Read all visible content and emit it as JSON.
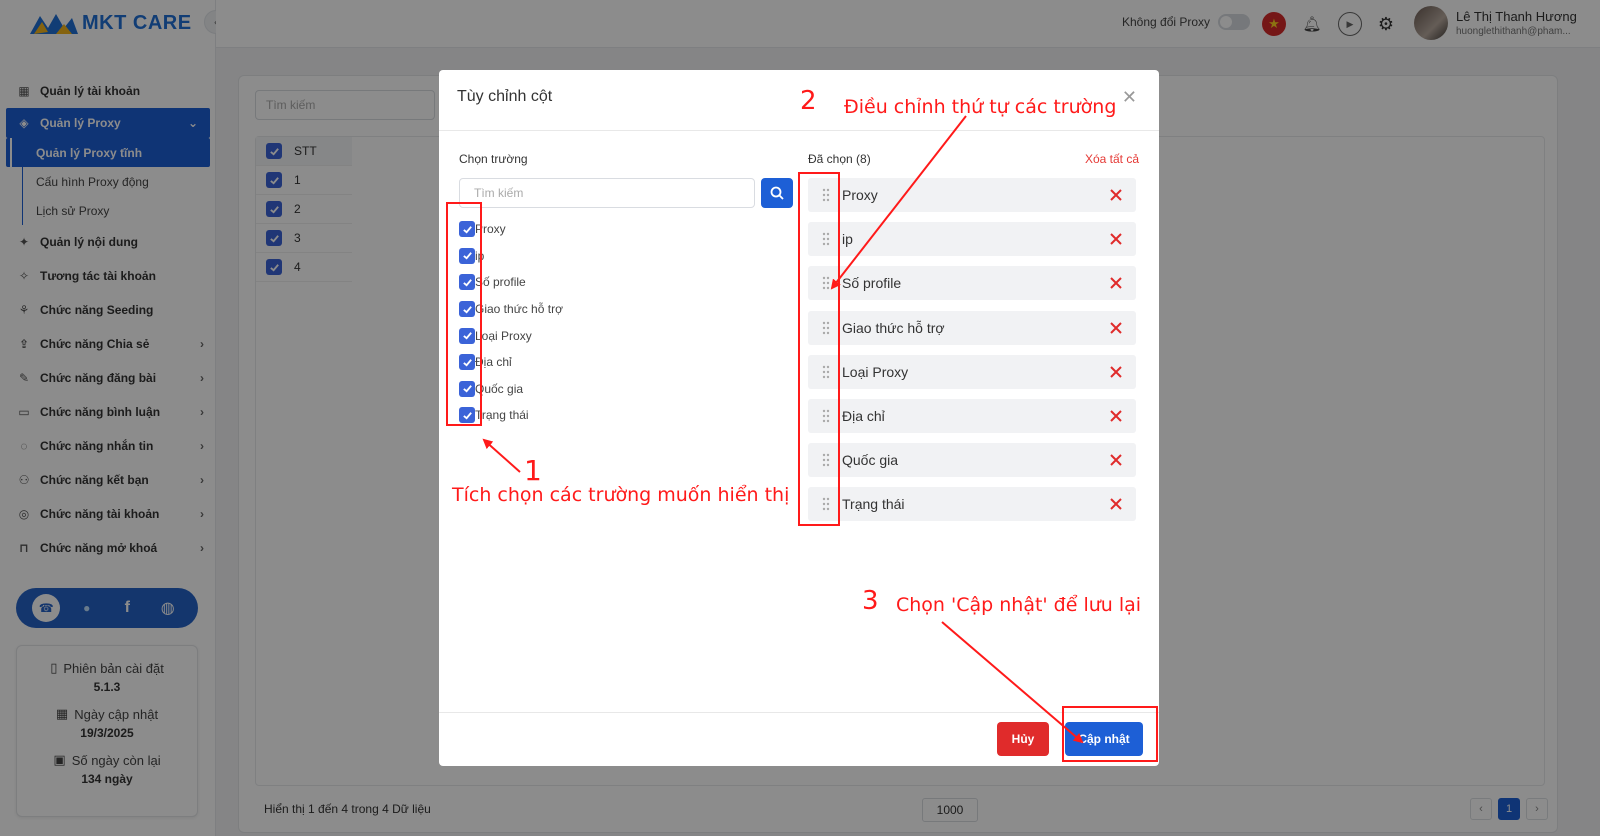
{
  "app": {
    "brand": "MKT CARE",
    "brand_color": "#1d5fd6"
  },
  "topbar": {
    "proxy_toggle_label": "Không đổi Proxy",
    "user_name": "Lê Thị Thanh Hương",
    "user_email": "huonglethithanh@pham..."
  },
  "sidebar": {
    "items": [
      {
        "label": "Quản lý tài khoản",
        "icon": "grid-icon"
      },
      {
        "label": "Quản lý Proxy",
        "icon": "layers-icon"
      },
      {
        "label": "Quản lý Proxy tĩnh"
      },
      {
        "label": "Cấu hình Proxy động"
      },
      {
        "label": "Lịch sử Proxy"
      },
      {
        "label": "Quản lý nội dung",
        "icon": "content-icon"
      },
      {
        "label": "Tương tác tài khoản",
        "icon": "sparkle-icon"
      },
      {
        "label": "Chức năng Seeding",
        "icon": "seeding-icon"
      },
      {
        "label": "Chức năng Chia sẻ",
        "icon": "share-icon"
      },
      {
        "label": "Chức năng đăng bài",
        "icon": "post-icon"
      },
      {
        "label": "Chức năng bình luận",
        "icon": "comment-icon"
      },
      {
        "label": "Chức năng nhắn tin",
        "icon": "chat-icon"
      },
      {
        "label": "Chức năng kết bạn",
        "icon": "add-friend-icon"
      },
      {
        "label": "Chức năng tài khoản",
        "icon": "account-icon"
      },
      {
        "label": "Chức năng mở khoá",
        "icon": "lock-icon"
      }
    ],
    "version": {
      "install_label": "Phiên bản cài đặt",
      "install_value": "5.1.3",
      "update_label": "Ngày cập nhật",
      "update_value": "19/3/2025",
      "days_label": "Số ngày còn lại",
      "days_value": "134 ngày"
    }
  },
  "background": {
    "search_placeholder": "Tìm kiếm",
    "table_header": "STT",
    "rows": [
      "1",
      "2",
      "3",
      "4"
    ],
    "footer_text": "Hiển thị 1 đến 4 trong 4 Dữ liệu",
    "page_size": "1000",
    "current_page": "1"
  },
  "modal": {
    "title": "Tùy chỉnh cột",
    "left_title": "Chọn trường",
    "search_placeholder": "Tìm kiếm",
    "fields": [
      "Proxy",
      "ip",
      "Số profile",
      "Giao thức hỗ trợ",
      "Loại Proxy",
      "Địa chỉ",
      "Quốc gia",
      "Trạng thái"
    ],
    "right_title": "Đã chọn (8)",
    "clear_all": "Xóa tất cả",
    "selected": [
      "Proxy",
      "ip",
      "Số profile",
      "Giao thức hỗ trợ",
      "Loại Proxy",
      "Địa chỉ",
      "Quốc gia",
      "Trạng thái"
    ],
    "cancel_label": "Hủy",
    "update_label": "Cập nhật"
  },
  "annotations": {
    "n1": "1",
    "t1": "Tích chọn các trường muốn hiển thị",
    "n2": "2",
    "t2": "Điều chỉnh thứ tự các trường",
    "n3": "3",
    "t3": "Chọn 'Cập nhật' để lưu lại",
    "color": "#ff1a1a"
  }
}
